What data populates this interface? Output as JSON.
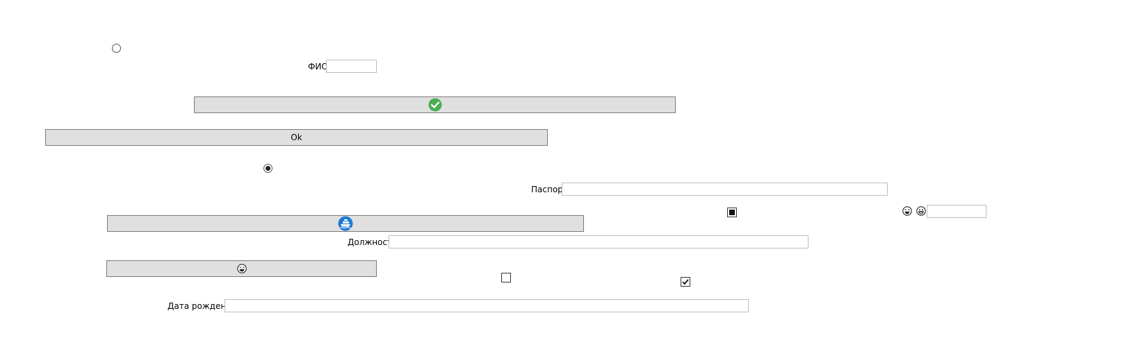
{
  "form": {
    "fio_label": "ФИО",
    "fio_value": "",
    "passport_label": "Паспорт",
    "passport_value": "",
    "position_label": "Должность",
    "position_value": "",
    "birthdate_label": "Дата рождения",
    "birthdate_value": "",
    "extra_value": ""
  },
  "buttons": {
    "ok_label": "Ok",
    "accept_icon": "green-check-icon",
    "ship_icon": "ship-icon",
    "emoji_icon": "laughing-face-icon"
  },
  "controls": {
    "radio_top_checked": false,
    "radio_mid_checked": true,
    "checkbox_indeterminate": true,
    "checkbox_unchecked": false,
    "checkbox_checked": true,
    "emoji_left": "laughing-face-icon",
    "emoji_right": "grinning-face-icon"
  },
  "colors": {
    "button_bg": "#e0e0e0",
    "button_border": "#7a7a7a",
    "input_border": "#bdbdbd",
    "check_green": "#4caf50",
    "ship_blue": "#1e7bd3"
  }
}
